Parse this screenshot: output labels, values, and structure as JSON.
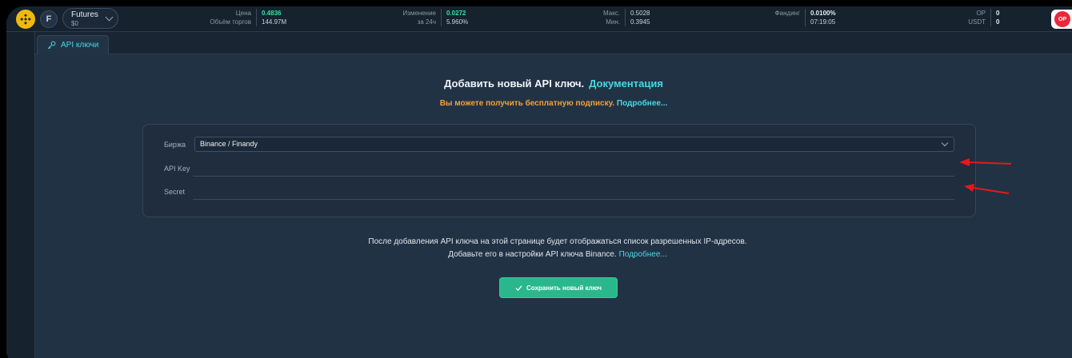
{
  "topbar": {
    "market": {
      "name": "Futures",
      "sub": "$0"
    },
    "stats": [
      {
        "label1": "Цена",
        "label2": "Объём торгов",
        "value1": "0.4836",
        "value2": "144.97M"
      },
      {
        "label1": "Изменение",
        "label2": "за 24ч",
        "value1": "0.0272",
        "value2": "5.960%"
      },
      {
        "label1": "Макс.",
        "label2": "Мин.",
        "value1": "0.5028",
        "value2": "0.3945"
      },
      {
        "label1": "Фандинг",
        "label2": "",
        "value1": "0.0100%",
        "value2": "07:19:05"
      },
      {
        "label1": "OP",
        "label2": "USDT",
        "value1": "0",
        "value2": "0"
      }
    ],
    "badge": "OP"
  },
  "tabs": [
    {
      "label": "API ключи",
      "icon": "key-icon"
    }
  ],
  "main": {
    "title": "Добавить новый API ключ.",
    "title_link": "Документация",
    "promo": "Вы можете получить бесплатную подписку.",
    "promo_link": "Подробнее...",
    "form": {
      "exchange_label": "Биржа",
      "exchange_value": "Binance / Finandy",
      "api_key_label": "API Key",
      "api_key_value": "",
      "secret_label": "Secret",
      "secret_value": ""
    },
    "info_line1": "После добавления API ключа на этой странице будет отображаться список разрешенных IP-адресов.",
    "info_line2": "Добавьте его в настройки API ключа Binance.",
    "info_link": "Подробнее...",
    "save_label": "Сохранить новый ключ"
  },
  "colors": {
    "accent": "#46d9e4",
    "promo": "#f0a23a",
    "positive": "#2fe3a0",
    "save": "#2bb78c",
    "annotation": "#e01b1b"
  }
}
